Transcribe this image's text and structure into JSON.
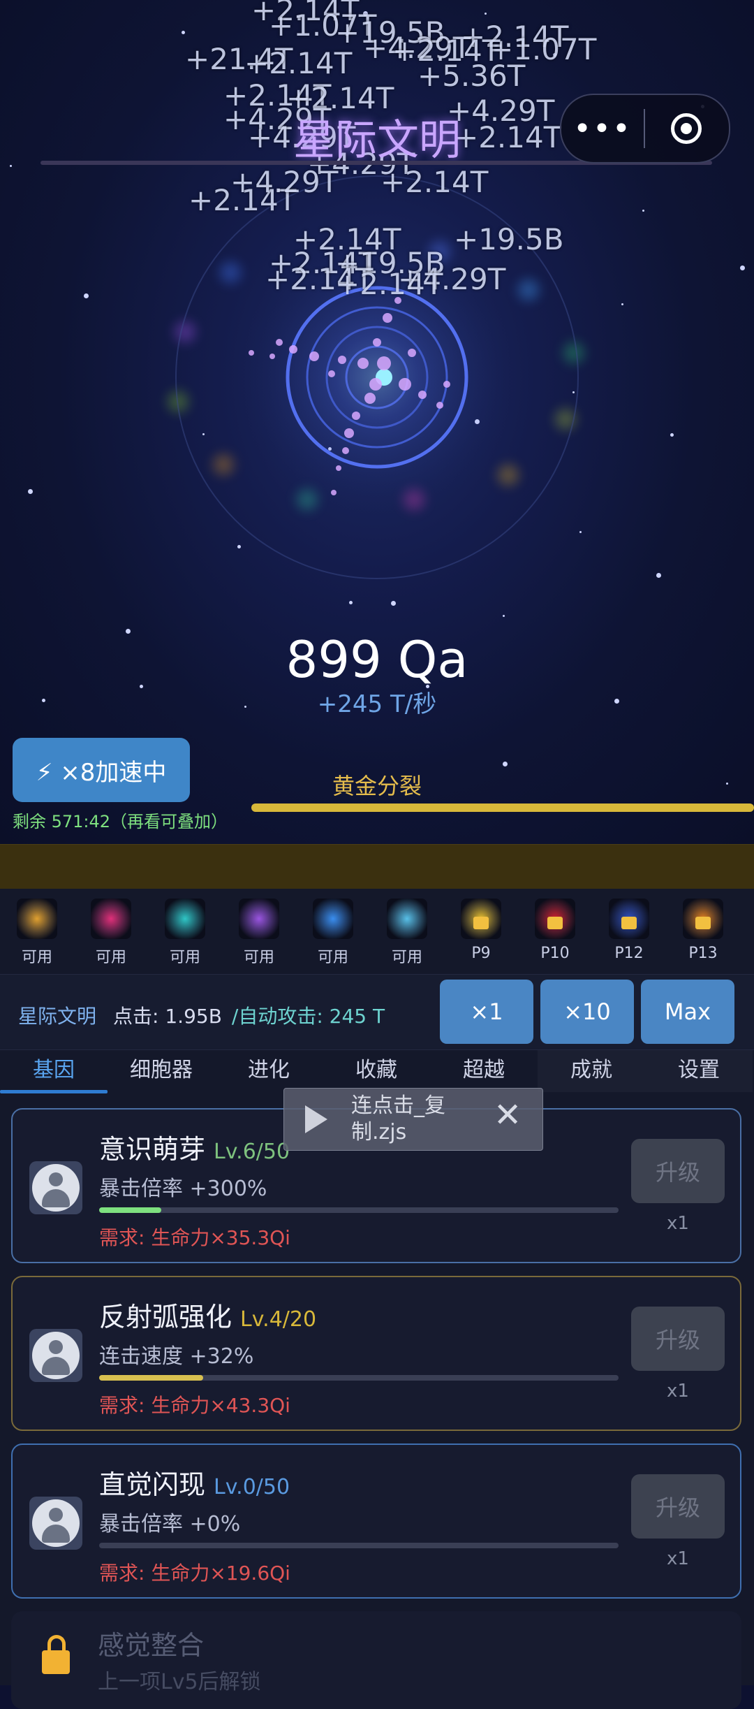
{
  "game": {
    "title": "星际文明",
    "resource": "899 Qa",
    "rate": "+245 T/秒",
    "floating_numbers": [
      "+2.14T",
      "+1.07T",
      "+19.5B",
      "+2.14T",
      "+4.29T",
      "+1.07T",
      "+2.14T",
      "+5.36T",
      "+21.4T",
      "+2.14T",
      "+2.14T",
      "+2.14T",
      "+4.29T",
      "+4.29T",
      "+4.29T",
      "+2.14T",
      "+4.29T",
      "+2.14T",
      "+4.29T",
      "+2.14T",
      "+2.14T",
      "+19.5B",
      "+2.14T",
      "+19.5B",
      "+2.14T",
      "+4.29T",
      "+2.14T"
    ],
    "boost_label": "⚡ ×8加速中",
    "boost_remaining": "剩余 571:42（再看可叠加）",
    "stage_label": "黄金分裂"
  },
  "abilities": [
    {
      "label": "可用",
      "color": "#e0a030"
    },
    {
      "label": "可用",
      "color": "#e0307a"
    },
    {
      "label": "可用",
      "color": "#2fc6c6"
    },
    {
      "label": "可用",
      "color": "#9a55e0"
    },
    {
      "label": "可用",
      "color": "#3a8ef0"
    },
    {
      "label": "可用",
      "color": "#58c0e8"
    },
    {
      "label": "P9",
      "color": "#e8c030"
    },
    {
      "label": "P10",
      "color": "#d02030"
    },
    {
      "label": "P12",
      "color": "#3050c0"
    },
    {
      "label": "P13",
      "color": "#e08020"
    }
  ],
  "stats": {
    "civ": "星际文明",
    "click": "点击: 1.95B",
    "auto": "/自动攻击: 245 T"
  },
  "multipliers": [
    "×1",
    "×10",
    "Max"
  ],
  "tabs": [
    "基因",
    "细胞器",
    "进化",
    "收藏",
    "超越",
    "成就",
    "设置"
  ],
  "overlay": {
    "file_name": "连点击_复制.zjs"
  },
  "upgrades": [
    {
      "name": "意识萌芽",
      "level": "Lv.6/50",
      "level_color": "#7ec27e",
      "effect": "暴击倍率 +300%",
      "progress": 0.12,
      "bar_color": "#7ee07f",
      "requirement": "需求: 生命力×35.3Qi",
      "button": "升级",
      "mult": "x1",
      "border": "#4a6fa5"
    },
    {
      "name": "反射弧强化",
      "level": "Lv.4/20",
      "level_color": "#d8b83a",
      "effect": "连击速度 +32%",
      "progress": 0.2,
      "bar_color": "#d8c050",
      "requirement": "需求: 生命力×43.3Qi",
      "button": "升级",
      "mult": "x1",
      "border": "#7a6a3a"
    },
    {
      "name": "直觉闪现",
      "level": "Lv.0/50",
      "level_color": "#5a9ae0",
      "effect": "暴击倍率 +0%",
      "progress": 0,
      "bar_color": "#5a9ae0",
      "requirement": "需求: 生命力×19.6Qi",
      "button": "升级",
      "mult": "x1",
      "border": "#3f6fb0"
    }
  ],
  "locked": {
    "name": "感觉整合",
    "subtitle": "上一项Lv5后解锁"
  }
}
